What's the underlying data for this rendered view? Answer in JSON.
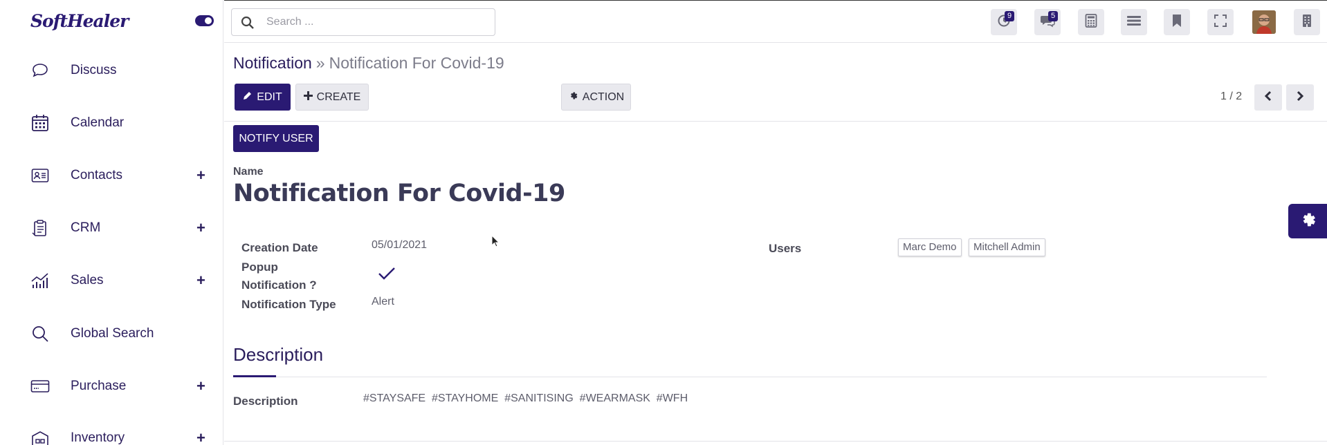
{
  "app": {
    "logo_text": "SoftHealer"
  },
  "sidebar": {
    "items": [
      {
        "label": "Discuss",
        "icon": "chat-bubble-icon",
        "expandable": false
      },
      {
        "label": "Calendar",
        "icon": "calendar-icon",
        "expandable": false
      },
      {
        "label": "Contacts",
        "icon": "contact-card-icon",
        "expandable": true,
        "plus": "+"
      },
      {
        "label": "CRM",
        "icon": "clipboard-icon",
        "expandable": true,
        "plus": "+"
      },
      {
        "label": "Sales",
        "icon": "bar-chart-icon",
        "expandable": true,
        "plus": "+"
      },
      {
        "label": "Global Search",
        "icon": "search-icon",
        "expandable": false
      },
      {
        "label": "Purchase",
        "icon": "credit-card-icon",
        "expandable": true,
        "plus": "+"
      },
      {
        "label": "Inventory",
        "icon": "boxes-icon",
        "expandable": true,
        "plus": "+"
      }
    ]
  },
  "topbar": {
    "search": {
      "placeholder": "Search ..."
    },
    "activity_badge": "9",
    "messages_badge": "5"
  },
  "breadcrumb": {
    "parent": "Notification",
    "separator": "»",
    "current": "Notification For Covid-19"
  },
  "toolbar": {
    "edit_label": "EDIT",
    "create_label": "CREATE",
    "action_label": "ACTION",
    "notify_user_label": "NOTIFY USER"
  },
  "pager": {
    "value": "1 / 2"
  },
  "form": {
    "name_label": "Name",
    "name_value": "Notification For Covid-19",
    "creation_date_label": "Creation Date",
    "creation_date_value": "05/01/2021",
    "popup_label_line1": "Popup",
    "popup_label_line2": "Notification ?",
    "popup_checked": true,
    "notification_type_label": "Notification Type",
    "notification_type_value": "Alert",
    "users_label": "Users",
    "users": [
      "Marc Demo",
      "Mitchell Admin"
    ],
    "section_title": "Description",
    "description_label": "Description",
    "description_value": "#STAYSAFE  #STAYHOME  #SANITISING  #WEARMASK  #WFH"
  },
  "colors": {
    "primary": "#2a1a73",
    "text": "#3c3c4d",
    "muted": "#7c7c8a"
  }
}
